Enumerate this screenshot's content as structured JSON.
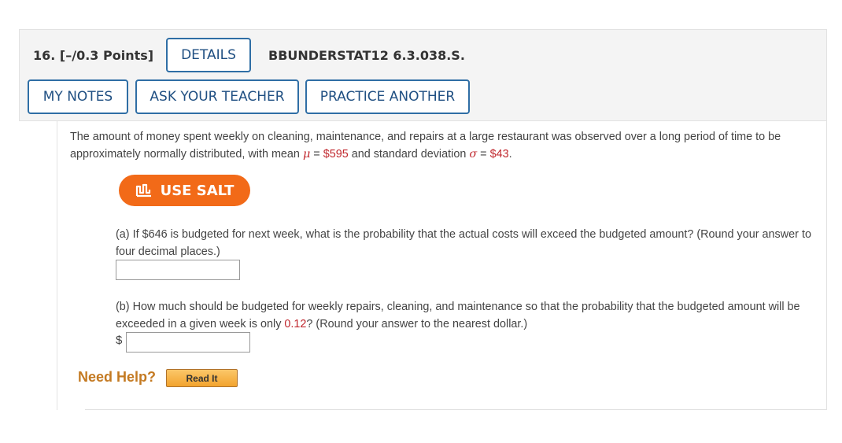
{
  "question": {
    "number_label": "16. [–/0.3 Points]",
    "details_label": "DETAILS",
    "code": "BBUNDERSTAT12 6.3.038.S.",
    "my_notes_label": "MY NOTES",
    "ask_teacher_label": "ASK YOUR TEACHER",
    "practice_another_label": "PRACTICE ANOTHER"
  },
  "stem": {
    "text_1": "The amount of money spent weekly on cleaning, maintenance, and repairs at a large restaurant was observed over a long period of time to be approximately normally distributed, with mean ",
    "mu_symbol": "μ",
    "equals_1": " = ",
    "mean_value": "$595",
    "text_2": " and standard deviation ",
    "sigma_symbol": "σ",
    "equals_2": " = ",
    "sd_value": "$43",
    "text_3": "."
  },
  "salt_button": {
    "label": "USE SALT",
    "icon": "salt-chart-icon"
  },
  "part_a": {
    "text": "(a) If $646 is budgeted for next week, what is the probability that the actual costs will exceed the budgeted amount? (Round your answer to four decimal places.)",
    "answer_value": ""
  },
  "part_b": {
    "text_1": "(b) How much should be budgeted for weekly repairs, cleaning, and maintenance so that the probability that the budgeted amount will be exceeded in a given week is only ",
    "prob_value": "0.12",
    "text_2": "? (Round your answer to the nearest dollar.)",
    "currency": "$",
    "answer_value": ""
  },
  "help": {
    "label": "Need Help?",
    "read_it_label": "Read It"
  },
  "colors": {
    "accent_blue": "#2f6ea5",
    "salt_orange": "#f26a18",
    "value_red": "#c0272d",
    "help_orange": "#c47a22"
  }
}
